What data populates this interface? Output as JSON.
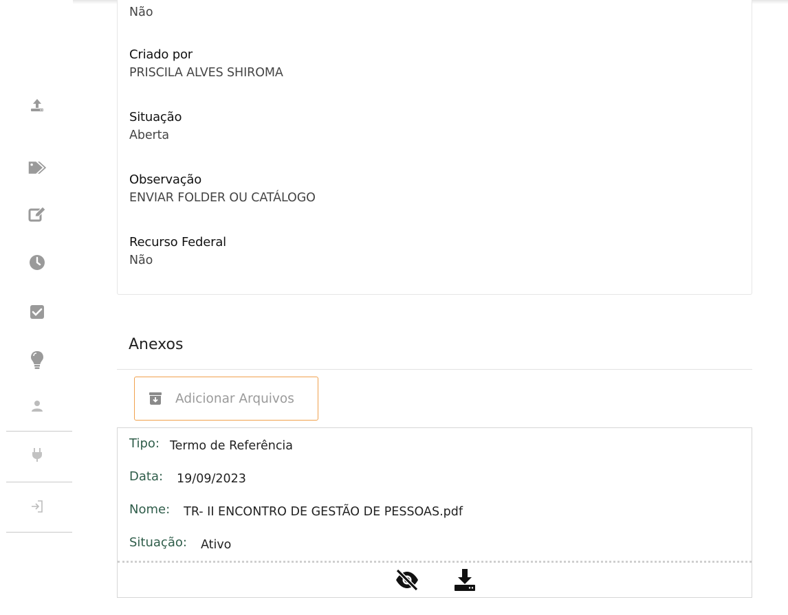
{
  "sidebar": {
    "icons": [
      {
        "name": "upload-icon"
      },
      {
        "name": "tags-icon"
      },
      {
        "name": "edit-icon"
      },
      {
        "name": "clock-icon"
      },
      {
        "name": "check-square-icon"
      },
      {
        "name": "lightbulb-icon"
      },
      {
        "name": "user-icon"
      },
      {
        "name": "plug-icon"
      },
      {
        "name": "sign-in-icon"
      }
    ]
  },
  "details": {
    "first_value": "Não",
    "fields": [
      {
        "label": "Criado por",
        "value": "PRISCILA ALVES SHIROMA"
      },
      {
        "label": "Situação",
        "value": "Aberta"
      },
      {
        "label": "Observação",
        "value": "ENVIAR FOLDER OU CATÁLOGO"
      },
      {
        "label": "Recurso Federal",
        "value": "Não"
      }
    ]
  },
  "attachments": {
    "title": "Anexos",
    "add_button_label": "Adicionar Arquivos",
    "item": {
      "tipo_label": "Tipo:",
      "tipo_value": "Termo de Referência",
      "data_label": "Data:",
      "data_value": "19/09/2023",
      "nome_label": "Nome:",
      "nome_value": "TR- II ENCONTRO DE GESTÃO DE PESSOAS.pdf",
      "situacao_label": "Situação:",
      "situacao_value": "Ativo"
    },
    "actions": [
      {
        "name": "eye-slash-icon"
      },
      {
        "name": "download-icon"
      }
    ]
  },
  "colors": {
    "accent_border": "#f0a04b",
    "label_green": "#2f5d4a",
    "sidebar_icon": "#9a9a9a"
  }
}
